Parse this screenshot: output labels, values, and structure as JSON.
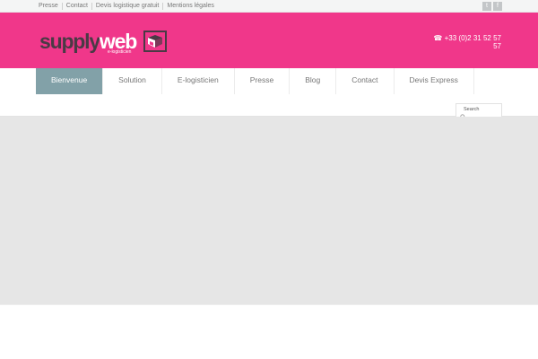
{
  "topbar": {
    "links": [
      "Presse",
      "Contact",
      "Devis logistique gratuit",
      "Mentions légales"
    ],
    "social": [
      {
        "name": "twitter-icon",
        "glyph": "t"
      },
      {
        "name": "facebook-icon",
        "glyph": "f"
      }
    ]
  },
  "header": {
    "brand_supply": "supply",
    "brand_web": "web",
    "brand_tagline": "e-logisticien",
    "phone": "☎ +33 (0)2 31 52 57 57",
    "accent_color": "#f0378a"
  },
  "nav": {
    "items": [
      "Bienvenue",
      "Solution",
      "E-logisticien",
      "Presse",
      "Blog",
      "Contact",
      "Devis Express"
    ],
    "active_index": 0,
    "active_color": "#82a1a8"
  },
  "search": {
    "label": "Search"
  }
}
